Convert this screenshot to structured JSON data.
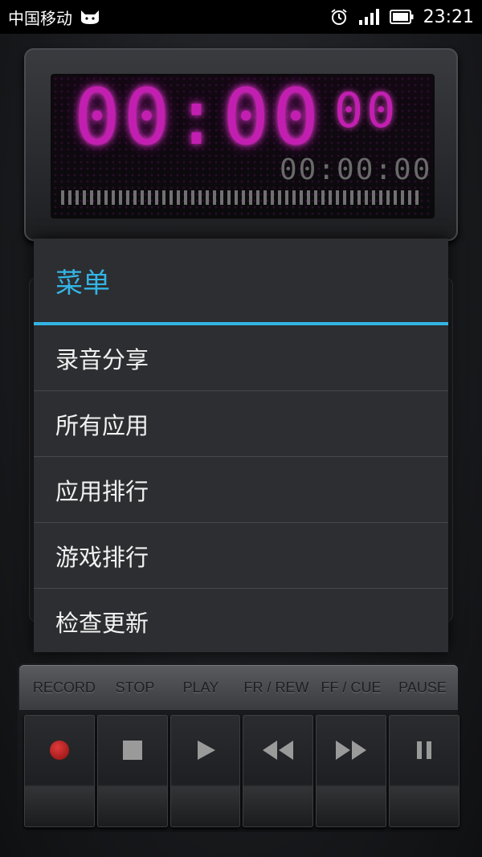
{
  "status_bar": {
    "carrier": "中国移动",
    "time": "23:21"
  },
  "display": {
    "main_time": "00:00",
    "main_sub": "00",
    "small_time": "00:00:00"
  },
  "menu": {
    "title": "菜单",
    "items": [
      {
        "label": "录音分享"
      },
      {
        "label": "所有应用"
      },
      {
        "label": "应用排行"
      },
      {
        "label": "游戏排行"
      },
      {
        "label": "检查更新"
      }
    ]
  },
  "controls": {
    "labels": [
      "RECORD",
      "STOP",
      "PLAY",
      "FR / REW",
      "FF / CUE",
      "PAUSE"
    ]
  },
  "colors": {
    "accent": "#33b5e5",
    "lcd": "#c21fb1",
    "record": "#c0392b"
  }
}
